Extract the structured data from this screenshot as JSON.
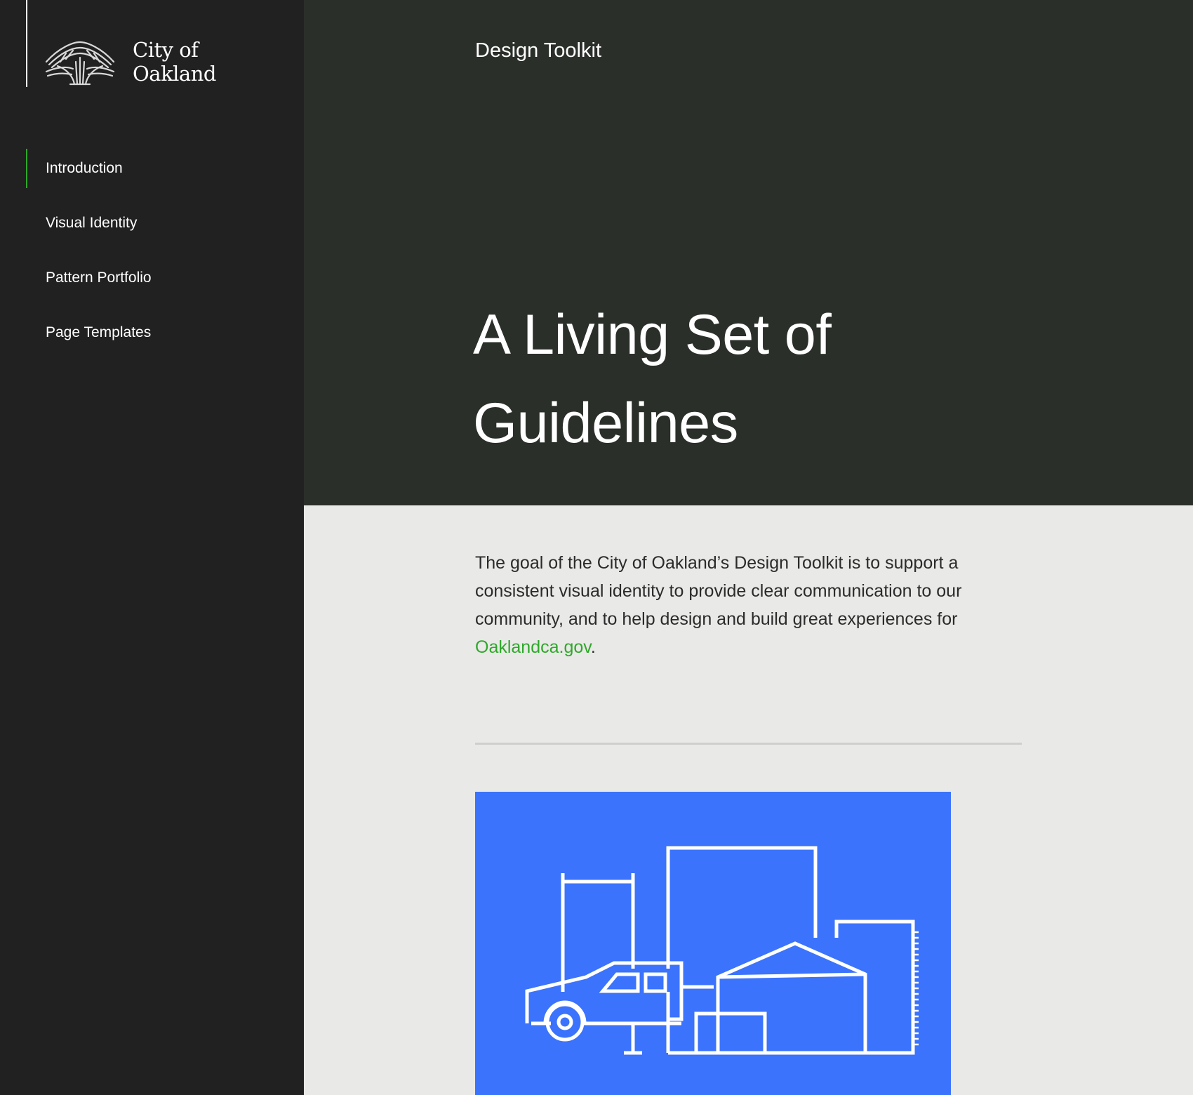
{
  "brand": {
    "logo_icon": "oak-tree-icon",
    "name_line1": "City of",
    "name_line2": "Oakland"
  },
  "nav": {
    "items": [
      {
        "label": "Introduction",
        "active": true
      },
      {
        "label": "Visual Identity",
        "active": false
      },
      {
        "label": "Pattern Portfolio",
        "active": false
      },
      {
        "label": "Page Templates",
        "active": false
      }
    ]
  },
  "hero": {
    "eyebrow": "Design Toolkit",
    "title_line1": "A Living Set of",
    "title_line2": "Guidelines"
  },
  "intro": {
    "text": "The goal of the City of Oakland’s Design Toolkit is to support a consistent visual identity to provide clear communication to our community, and to help design and build great experiences for ",
    "link_text": "Oaklandca.gov",
    "trailing": "."
  },
  "illustration": {
    "icon": "city-buildings-truck-icon"
  },
  "colors": {
    "sidebar_bg": "#212121",
    "hero_bg": "#2a2f29",
    "content_bg": "#e9e9e7",
    "accent_green": "#2fa82a",
    "illustration_blue": "#3b73fc"
  }
}
